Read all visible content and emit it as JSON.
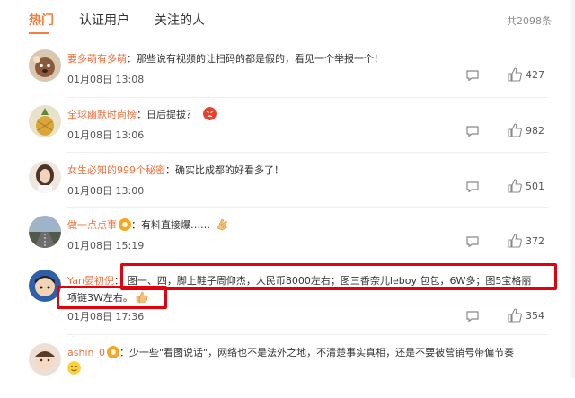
{
  "tabs": [
    {
      "label": "热门",
      "active": true
    },
    {
      "label": "认证用户",
      "active": false
    },
    {
      "label": "关注的人",
      "active": false
    }
  ],
  "total": "共2098条",
  "colors": {
    "accent": "#fa7d3c",
    "username": "#eb7340",
    "highlight_box": "#e3000f"
  },
  "comments": [
    {
      "user": "要多萌有多萌",
      "colon": "：",
      "text": "那些说有视频的让扫码的都是假的，看见一个举报一个！",
      "time": "01月08日 13:08",
      "likes": "427",
      "emoji": "",
      "avatar_icon": "dog-avatar-icon"
    },
    {
      "user": "全球幽默时尚榜",
      "colon": "：",
      "text": "日后提拔？",
      "time": "01月08日 13:06",
      "likes": "982",
      "emoji": "angry-face-emoji",
      "avatar_icon": "pineapple-avatar-icon"
    },
    {
      "user": "女生必知的999个秘密",
      "colon": "：",
      "text": "确实比成都的好看多了！",
      "time": "01月08日 13:00",
      "likes": "501",
      "emoji": "",
      "avatar_icon": "girl-avatar-icon"
    },
    {
      "user": "做一点点事",
      "colon": "：",
      "text": "有料直接爆……",
      "time": "01月08日 15:19",
      "likes": "372",
      "emoji": "clap-hands-emoji",
      "avatar_icon": "road-avatar-icon",
      "badge": "fan-badge-icon"
    },
    {
      "user": "Yan晏初倪",
      "colon": "：",
      "text": "图一、四，脚上鞋子周仰杰，人民币8000左右；图三香奈儿leboy 包包，6W多；图5宝格丽",
      "text2": "项链3W左右。",
      "time": "01月08日 17:36",
      "likes": "354",
      "emoji": "thumbs-up-emoji",
      "avatar_icon": "cartoon-avatar-icon"
    },
    {
      "user": "ashin_0",
      "colon": "：",
      "text": "少一些\"看图说话\"，网络也不是法外之地，不清楚事实真相，还是不要被营销号带偏节奏",
      "time": "",
      "likes": "",
      "emoji": "smile-emoji",
      "avatar_icon": "baby-avatar-icon",
      "badge": "fan-badge-icon"
    }
  ]
}
